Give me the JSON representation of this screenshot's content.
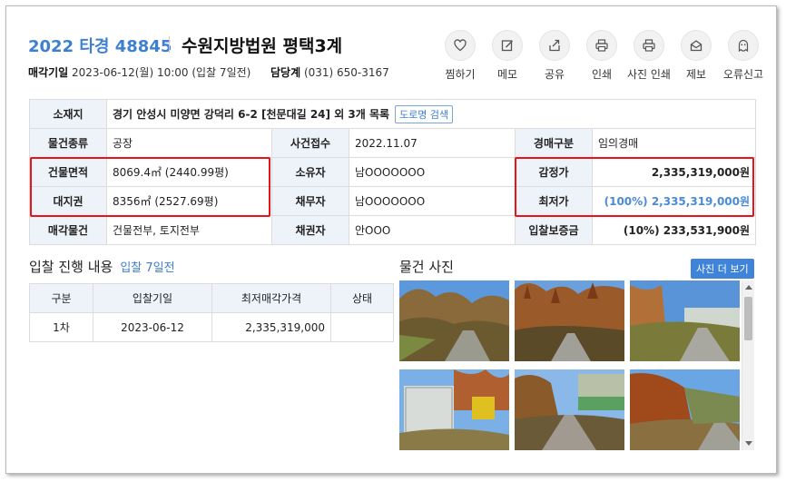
{
  "header": {
    "case_no": "2022 타경 48845",
    "court": "수원지방법원 평택3계",
    "sale_date_label": "매각기일",
    "sale_date_value": "2023-06-12(월) 10:00 (입찰 7일전)",
    "dept_label": "담당계",
    "dept_value": "(031) 650-3167"
  },
  "actions": [
    {
      "label": "찜하기",
      "icon": "heart-icon"
    },
    {
      "label": "메모",
      "icon": "memo-icon"
    },
    {
      "label": "공유",
      "icon": "share-icon"
    },
    {
      "label": "인쇄",
      "icon": "print-icon"
    },
    {
      "label": "사진 인쇄",
      "icon": "print-icon"
    },
    {
      "label": "제보",
      "icon": "report-icon"
    },
    {
      "label": "오류신고",
      "icon": "ghost-icon"
    }
  ],
  "info": {
    "address_label": "소재지",
    "address_value": "경기 안성시 미양면 강덕리 6-2 [천문대길 24] 외 3개 목록",
    "road_search": "도로명 검색",
    "type_label": "물건종류",
    "type_value": "공장",
    "filed_label": "사건접수",
    "filed_value": "2022.11.07",
    "auction_kind_label": "경매구분",
    "auction_kind_value": "임의경매",
    "building_area_label": "건물면적",
    "building_area_value": "8069.4㎡ (2440.99평)",
    "owner_label": "소유자",
    "owner_value": "남OOOOOOO",
    "appraisal_label": "감정가",
    "appraisal_value": "2,335,319,000원",
    "land_label": "대지권",
    "land_value": "8356㎡ (2527.69평)",
    "debtor_label": "채무자",
    "debtor_value": "남OOOOOOO",
    "min_price_label": "최저가",
    "min_price_value": "(100%) 2,335,319,000원",
    "sale_items_label": "매각물건",
    "sale_items_value": "건물전부, 토지전부",
    "creditor_label": "채권자",
    "creditor_value": "안OOO",
    "deposit_label": "입찰보증금",
    "deposit_value": "(10%) 233,531,900원"
  },
  "bids": {
    "title": "입찰 진행 내용",
    "subtitle": "입찰 7일전",
    "headers": [
      "구분",
      "입찰기일",
      "최저매각가격",
      "상태"
    ],
    "rows": [
      [
        "1차",
        "2023-06-12",
        "2,335,319,000",
        ""
      ]
    ]
  },
  "photos": {
    "title": "물건 사진",
    "more_button": "사진 더 보기",
    "count": 6
  }
}
